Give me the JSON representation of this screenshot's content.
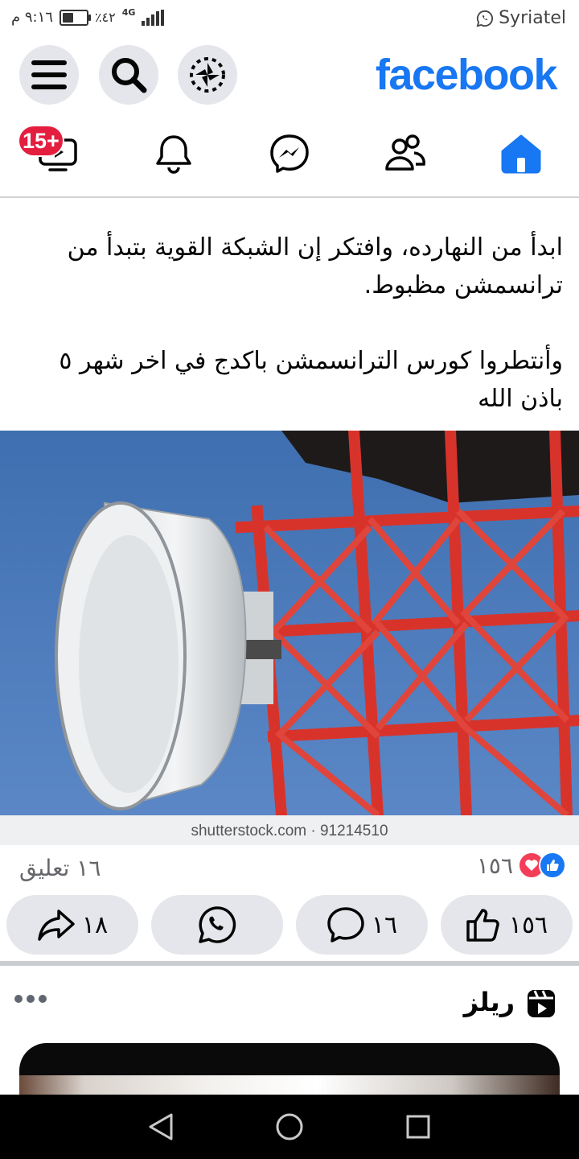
{
  "status_bar": {
    "carrier": "Syriatel",
    "time": "٩:١٦ م",
    "battery_text": "٪٤٢",
    "network": "4G",
    "battery_level": 0.42
  },
  "header": {
    "logo_text": "facebook",
    "brand_color": "#1877f2",
    "buttons": [
      "menu-icon",
      "search-icon",
      "pinwheel-icon"
    ]
  },
  "nav": {
    "tabs": [
      "home-icon",
      "friends-icon",
      "messenger-icon",
      "notifications-icon",
      "video-icon"
    ],
    "video_badge": "15+",
    "badge_color": "#e41e3f"
  },
  "post": {
    "text_paragraph_1": "ابدأ من النهارده، وافتكر إن الشبكة القوية بتبدأ من ترانسمشن مظبوط.",
    "text_paragraph_2": "وأنتطروا كورس الترانسمشن باكدج في اخر شهر ٥ باذن الله",
    "image_watermark": "shutterstock.com · 91214510",
    "reactions_count": "١٥٦",
    "comments_summary": "١٦ تعليق",
    "actions": {
      "like_count": "١٥٦",
      "comment_count": "١٦",
      "share_count": "١٨"
    }
  },
  "reels": {
    "title": "ريلز"
  }
}
